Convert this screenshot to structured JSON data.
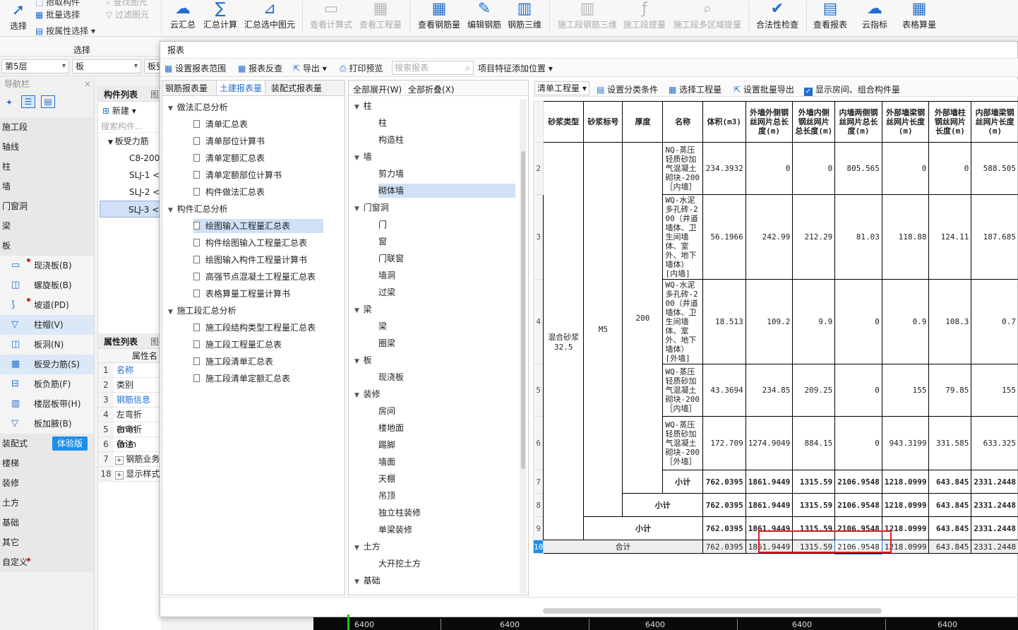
{
  "ribbon": {
    "select_group": {
      "select_label": "选择",
      "pick_label": "拾取构件",
      "batch_label": "批量选择",
      "attr_label": "按属性选择",
      "find_label": "查找图元",
      "filter_label": "过滤图元",
      "group_label": "选择"
    },
    "buttons": [
      {
        "label": "云汇总",
        "icon": "cloud-sum-icon",
        "enabled": true
      },
      {
        "label": "汇总计算",
        "icon": "sum-icon",
        "enabled": true
      },
      {
        "label": "汇总选中图元",
        "icon": "sum-selected-icon",
        "enabled": true
      },
      {
        "label": "查看计算式",
        "icon": "view-formula-icon",
        "enabled": false
      },
      {
        "label": "查看工程量",
        "icon": "view-quantity-icon",
        "enabled": false
      },
      {
        "label": "查看钢筋量",
        "icon": "view-rebar-icon",
        "enabled": true
      },
      {
        "label": "编辑钢筋",
        "icon": "edit-rebar-icon",
        "enabled": true
      },
      {
        "label": "钢筋三维",
        "icon": "rebar-3d-icon",
        "enabled": true
      },
      {
        "label": "施工段钢筋三维",
        "icon": "stage-rebar-3d-icon",
        "enabled": false
      },
      {
        "label": "施工段提量",
        "icon": "stage-quantity-icon",
        "enabled": false
      },
      {
        "label": "施工段多区域提量",
        "icon": "stage-multi-area-icon",
        "enabled": false
      },
      {
        "label": "合法性检查",
        "icon": "check-icon",
        "enabled": true
      },
      {
        "label": "查看报表",
        "icon": "view-report-icon",
        "enabled": true
      },
      {
        "label": "云指标",
        "icon": "cloud-index-icon",
        "enabled": true
      },
      {
        "label": "表格算量",
        "icon": "table-calc-icon",
        "enabled": true
      }
    ]
  },
  "floor_bar": {
    "floor": "第5层",
    "type": "板",
    "subtype": "板受"
  },
  "nav": {
    "title": "导航栏",
    "items": [
      "施工段",
      "轴线",
      "柱",
      "墙",
      "门窗洞",
      "梁",
      "板"
    ],
    "board_subitems": [
      {
        "label": "现浇板(B)",
        "icon": "slab-icon",
        "dot": true
      },
      {
        "label": "螺旋板(B)",
        "icon": "spiral-slab-icon",
        "dot": false
      },
      {
        "label": "坡道(PD)",
        "icon": "ramp-icon",
        "dot": true
      },
      {
        "label": "柱帽(V)",
        "icon": "column-cap-icon",
        "dot": false
      },
      {
        "label": "板洞(N)",
        "icon": "slab-hole-icon",
        "dot": false
      },
      {
        "label": "板受力筋(S)",
        "icon": "slab-rebar-icon",
        "dot": false
      },
      {
        "label": "板负筋(F)",
        "icon": "neg-rebar-icon",
        "dot": false
      },
      {
        "label": "楼层板带(H)",
        "icon": "floor-strip-icon",
        "dot": false
      },
      {
        "label": "板加腋(B)",
        "icon": "haunch-icon",
        "dot": false
      }
    ],
    "tail_items": [
      "装配式",
      "楼梯",
      "装修",
      "土方",
      "基础",
      "其它",
      "自定义"
    ],
    "trial_badge": "体验版"
  },
  "component_list": {
    "tab1": "构件列表",
    "tab2": "图",
    "new_label": "新建",
    "search_placeholder": "搜索构件...",
    "group": "板受力筋",
    "items": [
      "C8-200",
      "SLJ-1 <",
      "SLJ-2 <",
      "SLJ-3 <"
    ]
  },
  "property_list": {
    "tab1": "属性列表",
    "tab2": "图",
    "header": "属性名",
    "rows": [
      {
        "no": "1",
        "name": "名称"
      },
      {
        "no": "2",
        "name": "类别"
      },
      {
        "no": "3",
        "name": "钢筋信息"
      },
      {
        "no": "4",
        "name": "左弯折(mm"
      },
      {
        "no": "5",
        "name": "右弯折(mm"
      },
      {
        "no": "6",
        "name": "备注"
      },
      {
        "no": "7",
        "name": "钢筋业务"
      },
      {
        "no": "18",
        "name": "显示样式"
      }
    ]
  },
  "dialog": {
    "title": "报表",
    "toolbar": {
      "set_scope": "设置报表范围",
      "reverse": "报表反查",
      "export": "导出",
      "print_preview": "打印预览",
      "search_placeholder": "搜索报表",
      "add_position": "项目特征添加位置"
    },
    "tabs": [
      "钢筋报表量",
      "土建报表量",
      "装配式报表量"
    ],
    "report_tree": [
      {
        "type": "group",
        "label": "做法汇总分析"
      },
      {
        "type": "leaf",
        "label": "清单汇总表"
      },
      {
        "type": "leaf",
        "label": "清单部位计算书"
      },
      {
        "type": "leaf",
        "label": "清单定额汇总表"
      },
      {
        "type": "leaf",
        "label": "清单定额部位计算书"
      },
      {
        "type": "leaf",
        "label": "构件做法汇总表"
      },
      {
        "type": "group",
        "label": "构件汇总分析"
      },
      {
        "type": "leaf",
        "label": "绘图输入工程量汇总表",
        "selected": true
      },
      {
        "type": "leaf",
        "label": "构件绘图输入工程量汇总表"
      },
      {
        "type": "leaf",
        "label": "绘图输入构件工程量计算书"
      },
      {
        "type": "leaf",
        "label": "高强节点混凝土工程量汇总表"
      },
      {
        "type": "leaf",
        "label": "表格算量工程量计算书"
      },
      {
        "type": "group",
        "label": "施工段汇总分析"
      },
      {
        "type": "leaf",
        "label": "施工段结构类型工程量汇总表"
      },
      {
        "type": "leaf",
        "label": "施工段工程量汇总表"
      },
      {
        "type": "leaf",
        "label": "施工段清单汇总表"
      },
      {
        "type": "leaf",
        "label": "施工段清单定额汇总表"
      }
    ],
    "expand_all": "全部展开(W)",
    "collapse_all": "全部折叠(X)",
    "category_tree": [
      {
        "type": "group",
        "label": "柱"
      },
      {
        "type": "leaf",
        "label": "柱"
      },
      {
        "type": "leaf",
        "label": "构造柱"
      },
      {
        "type": "group",
        "label": "墙"
      },
      {
        "type": "leaf",
        "label": "剪力墙"
      },
      {
        "type": "leaf",
        "label": "砌体墙",
        "selected": true
      },
      {
        "type": "group",
        "label": "门窗洞"
      },
      {
        "type": "leaf",
        "label": "门"
      },
      {
        "type": "leaf",
        "label": "窗"
      },
      {
        "type": "leaf",
        "label": "门联窗"
      },
      {
        "type": "leaf",
        "label": "墙洞"
      },
      {
        "type": "leaf",
        "label": "过梁"
      },
      {
        "type": "group",
        "label": "梁"
      },
      {
        "type": "leaf",
        "label": "梁"
      },
      {
        "type": "leaf",
        "label": "圈梁"
      },
      {
        "type": "group",
        "label": "板"
      },
      {
        "type": "leaf",
        "label": "现浇板"
      },
      {
        "type": "group",
        "label": "装修"
      },
      {
        "type": "leaf",
        "label": "房间"
      },
      {
        "type": "leaf",
        "label": "楼地面"
      },
      {
        "type": "leaf",
        "label": "踢脚"
      },
      {
        "type": "leaf",
        "label": "墙面"
      },
      {
        "type": "leaf",
        "label": "天棚"
      },
      {
        "type": "leaf",
        "label": "吊顶"
      },
      {
        "type": "leaf",
        "label": "独立柱装修"
      },
      {
        "type": "leaf",
        "label": "单梁装修"
      },
      {
        "type": "group",
        "label": "土方"
      },
      {
        "type": "leaf",
        "label": "大开挖土方"
      },
      {
        "type": "group",
        "label": "基础"
      }
    ],
    "table_toolbar": {
      "mode": "清单工程量",
      "set_category": "设置分类条件",
      "select_quantity": "选择工程量",
      "batch_export": "设置批量导出",
      "show_room": "显示房间、组合构件量",
      "show_room_checked": true
    },
    "table": {
      "headers": [
        "砂浆类型",
        "砂浆标号",
        "厚度",
        "名称",
        "体积(m3)",
        "外墙外侧钢丝网片总长度(m)",
        "外墙内侧钢丝网片总长度(m)",
        "内墙两侧钢丝网片总长度(m)",
        "外部墙梁钢丝网片长度(m)",
        "外部墙柱钢丝网片长度(m)",
        "内部墙梁钢丝网片长度(m)"
      ],
      "mortar_type": "混合砂浆32.5",
      "mortar_grade": "M5",
      "thickness": "200",
      "rows": [
        {
          "no": "2",
          "name": "NQ-蒸压轻质砂加气混凝土砌块-200［内墙］",
          "v": [
            "234.3932",
            "0",
            "0",
            "805.565",
            "0",
            "0",
            "588.505"
          ]
        },
        {
          "no": "3",
          "name": "WQ-水泥多孔砖-200（井道墙体、卫生间墙体、室外、地下墙体）[内墙]",
          "v": [
            "56.1966",
            "242.99",
            "212.29",
            "81.03",
            "118.88",
            "124.11",
            "187.685"
          ]
        },
        {
          "no": "4",
          "name": "WQ-水泥多孔砖-200（井道墙体、卫生间墙体、室外、地下墙体）[外墙]",
          "v": [
            "18.513",
            "109.2",
            "9.9",
            "0",
            "0.9",
            "108.3",
            "0.7"
          ]
        },
        {
          "no": "5",
          "name": "WQ-蒸压轻质砂加气混凝土砌块-200［内墙］",
          "v": [
            "43.3694",
            "234.85",
            "209.25",
            "0",
            "155",
            "79.85",
            "155"
          ]
        },
        {
          "no": "6",
          "name": "WQ-蒸压轻质砂加气混凝土砌块-200［外墙］",
          "v": [
            "172.709",
            "1274.9049",
            "884.15",
            "0",
            "943.3199",
            "331.585",
            "633.325"
          ]
        }
      ],
      "subtotal_label": "小计",
      "subtotal": [
        "762.0395",
        "1861.9449",
        "1315.59",
        "2106.9548",
        "1218.0999",
        "643.845",
        "2331.2448"
      ],
      "subtotal_rows": [
        "7",
        "8",
        "9"
      ],
      "total_label": "合计",
      "total_row_no": "10",
      "total": [
        "762.0395",
        "1861.9449",
        "1315.59",
        "2106.9548",
        "1218.0999",
        "643.845",
        "2331.2448"
      ]
    }
  },
  "canvas_ruler": [
    "6400",
    "6400",
    "6400",
    "6400",
    "6400"
  ]
}
